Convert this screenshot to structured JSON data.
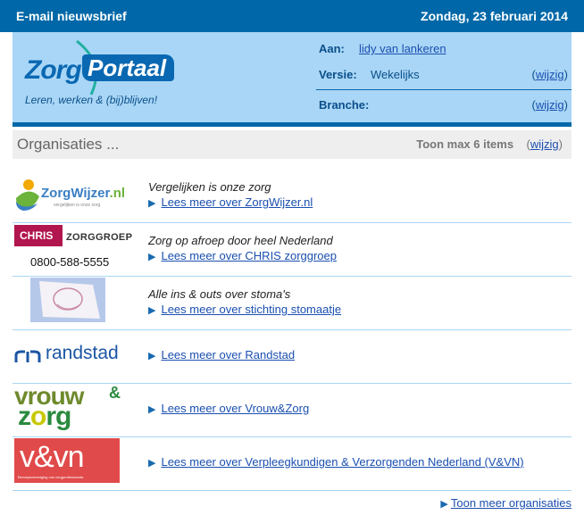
{
  "topbar": {
    "title": "E-mail nieuwsbrief",
    "date": "Zondag, 23 februari 2014"
  },
  "colors": {
    "brand_blue": "#0068a8",
    "header_bg": "#a9d6f6",
    "link": "#1a4fb0"
  },
  "header": {
    "logo": {
      "word1": "Zorg",
      "word2": "Portaal",
      "slogan": "Leren, werken & (bij)blijven!"
    },
    "aan_label": "Aan:",
    "aan_value": "lidy van lankeren",
    "versie_label": "Versie:",
    "versie_value": "Wekelijks",
    "branche_label": "Branche:",
    "edit_label": "wijzig",
    "paren_open": "(",
    "paren_close": ")"
  },
  "orgs_section": {
    "title": "Organisaties ...",
    "max_label": "Toon max 6 items",
    "edit_label": "wijzig"
  },
  "organizations": [
    {
      "name": "ZorgWijzer.nl",
      "tagline": "Vergelijken is onze zorg",
      "link": "Lees meer over ZorgWijzer.nl",
      "logo": {
        "main": "ZorgWijzer",
        "suffix": ".nl",
        "sub": "vergelijken is onze zorg"
      }
    },
    {
      "name": "CHRIS zorggroep",
      "tagline": "Zorg op afroep door heel Nederland",
      "link": "Lees meer over CHRIS zorggroep",
      "logo": {
        "main": "CHRIS",
        "suffix": "ZORGGROEP",
        "phone": "0800-588-5555"
      }
    },
    {
      "name": "stichting stomaatje",
      "tagline": "Alle ins & outs over stoma's",
      "link": "Lees meer over stichting stomaatje"
    },
    {
      "name": "Randstad",
      "tagline": "",
      "link": "Lees meer over Randstad",
      "logo": {
        "main": "randstad"
      }
    },
    {
      "name": "Vrouw&Zorg",
      "tagline": "",
      "link": "Lees meer over Vrouw&Zorg",
      "logo": {
        "line1": "vrouw",
        "amp": "&",
        "line2a": "z",
        "line2o": "o",
        "line2b": "rg"
      }
    },
    {
      "name": "V&VN",
      "tagline": "",
      "link": "Lees meer over Verpleegkundigen & Verzorgenden Nederland (V&VN)",
      "logo": {
        "main": "v&vn",
        "sub": "Beroepsvereniging van zorgprofessionals"
      }
    }
  ],
  "footer": {
    "more_link": "Toon meer organisaties"
  }
}
